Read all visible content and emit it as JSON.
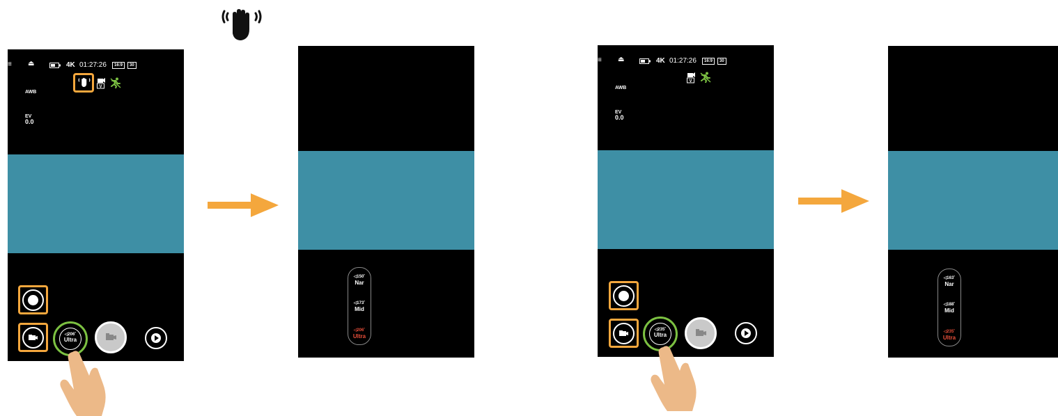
{
  "colors": {
    "accent": "#f4a73d",
    "teal": "#3e8fa5",
    "ring_green": "#7cc142",
    "active_red": "#e94f3a"
  },
  "icons": [
    "hand-wave-icon",
    "menu-icon",
    "eject-icon",
    "battery-icon",
    "stabilization-icon",
    "runner-icon",
    "shutter-icon",
    "video-camera-icon",
    "play-icon",
    "hand-pointer-icon",
    "arrow-right-icon"
  ],
  "left": {
    "status": {
      "resolution": "4K",
      "time": "01:27:26",
      "ratio": "16:9",
      "fps": "30"
    },
    "awb": "AWB",
    "ev_label": "EV",
    "ev_value": "0.0",
    "lens_button": {
      "angle": "206˚",
      "name": "Ultra"
    },
    "fov_options": [
      {
        "angle": "150˚",
        "name": "Nar",
        "active": false
      },
      {
        "angle": "173˚",
        "name": "Mid",
        "active": false
      },
      {
        "angle": "206˚",
        "name": "Ultra",
        "active": true
      }
    ]
  },
  "right": {
    "status": {
      "resolution": "4K",
      "time": "01:27:26",
      "ratio": "16:9",
      "fps": "30"
    },
    "awb": "AWB",
    "ev_label": "EV",
    "ev_value": "0.0",
    "lens_button": {
      "angle": "235˚",
      "name": "Ultra"
    },
    "fov_options": [
      {
        "angle": "163˚",
        "name": "Nar",
        "active": false
      },
      {
        "angle": "188˚",
        "name": "Mid",
        "active": false
      },
      {
        "angle": "235˚",
        "name": "Ultra",
        "active": true
      }
    ]
  }
}
